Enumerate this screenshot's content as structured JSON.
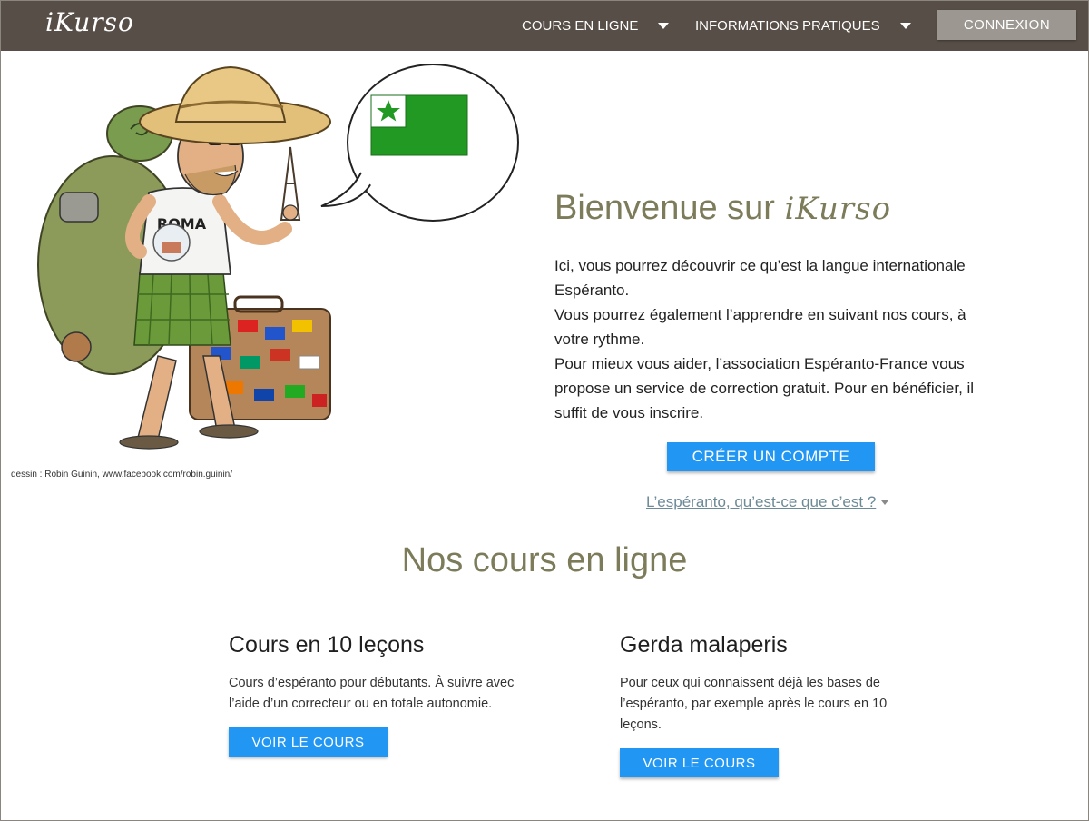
{
  "nav": {
    "logo": "iKurso",
    "menu_cours": "COURS EN LIGNE",
    "menu_infos": "INFORMATIONS PRATIQUES",
    "login_label": "CONNEXION"
  },
  "illustration": {
    "shirt_text": "ROMA",
    "credit": "dessin : Robin Guinin, www.facebook.com/robin.guinin/"
  },
  "welcome": {
    "title_prefix": "Bienvenue sur ",
    "title_brand": "iKurso",
    "paragraphs": [
      "Ici, vous pourrez découvrir ce qu’est la langue internationale Espéranto.",
      "Vous pourrez également l’apprendre en suivant nos cours, à votre rythme.",
      "Pour mieux vous aider, l’association Espéranto-France vous propose un service de correction gratuit. Pour en bénéficier, il suffit de vous inscrire."
    ],
    "create_account_label": "CRÉER UN COMPTE",
    "esperanto_link": "L’espéranto, qu’est-ce que c’est ?"
  },
  "courses": {
    "section_title": "Nos cours en ligne",
    "items": [
      {
        "title": "Cours en 10 leçons",
        "description": "Cours d’espéranto pour débutants. À suivre avec l’aide d’un correcteur ou en totale autonomie.",
        "button": "VOIR LE COURS"
      },
      {
        "title": "Gerda malaperis",
        "description": "Pour ceux qui connaissent déjà les bases de l’espéranto, par exemple après le cours en 10 leçons.",
        "button": "VOIR LE COURS"
      }
    ]
  },
  "colors": {
    "navbar": "#574e47",
    "primary": "#2196f3",
    "heading": "#7c7b5a",
    "link": "#6d8a97",
    "flag_green": "#229922"
  }
}
